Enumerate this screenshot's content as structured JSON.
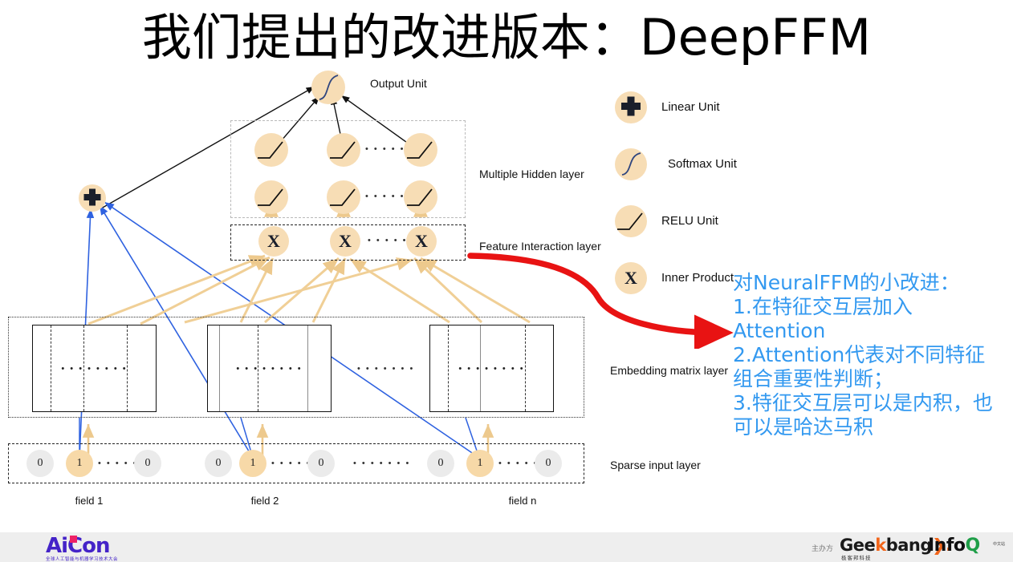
{
  "slide": {
    "title": "我们提出的改进版本：DeepFFM"
  },
  "diagram": {
    "output_unit_label": "Output Unit",
    "hidden_layer_label": "Multiple Hidden layer",
    "interaction_layer_label": "Feature Interaction layer",
    "embedding_layer_label": "Embedding matrix layer",
    "sparse_layer_label": "Sparse input layer",
    "ellipsis": "• • • • • • • •",
    "ellipsis_short": "• • • • • •",
    "linear_unit_symbol": "+",
    "inner_product_symbol": "X",
    "hidden_rows": [
      {
        "cells": [
          "relu",
          "relu",
          "ellipsis",
          "relu"
        ]
      },
      {
        "cells": [
          "relu",
          "relu",
          "ellipsis",
          "relu"
        ]
      }
    ],
    "interaction_cells": [
      "X",
      "X",
      "ellipsis",
      "X"
    ],
    "embedding_blocks": [
      {
        "dots": "• • • • • • • •"
      },
      {
        "dots": "• • • • • • • •"
      },
      {
        "dots": "• • • • • • • •"
      }
    ],
    "embedding_gap_dots": "• • • • • • •",
    "sparse_fields": [
      {
        "name": "field 1",
        "values": [
          "0",
          "1",
          "0"
        ],
        "hot_index": 1,
        "dots": "• • • • • • •"
      },
      {
        "name": "field 2",
        "values": [
          "0",
          "1",
          "0"
        ],
        "hot_index": 1,
        "dots": "• • • • • • •"
      },
      {
        "name": "field n",
        "values": [
          "0",
          "1",
          "0"
        ],
        "hot_index": 1,
        "dots": "• • • • • • •"
      }
    ],
    "sparse_gap_dots": "• • • • • • •"
  },
  "legend": {
    "items": [
      {
        "icon": "plus-icon",
        "label": "Linear Unit"
      },
      {
        "icon": "softmax-curve-icon",
        "label": "Softmax Unit"
      },
      {
        "icon": "relu-curve-icon",
        "label": "RELU Unit"
      },
      {
        "icon": "x-icon",
        "label": "Inner Product"
      }
    ]
  },
  "annotation": {
    "color": "#3399f0",
    "lines": [
      "对NeuralFFM的小改进：",
      "1.在特征交互层加入",
      "Attention",
      "2.Attention代表对不同特征",
      "组合重要性判断；",
      "3.特征交互层可以是内积，也",
      "可以是哈达马积"
    ]
  },
  "footer": {
    "aicon_word": "AiCon",
    "aicon_sub": "全球人工智能与机器学习技术大会",
    "sponsor_label": "主办方",
    "geekbang_pre": "Gee",
    "geekbang_k": "k",
    "geekbang_mid": "bang",
    "geekbang_post": "❯.",
    "geekbang_sub": "极客邦科技",
    "infoq_info": "Info",
    "infoq_q": "Q",
    "infoq_sub": "中文站"
  },
  "colors": {
    "unit_fill": "#f7ddb5",
    "sparse_zero": "#ebebeb",
    "sparse_one": "#f7d9a8",
    "blue_line": "#2f62e0",
    "tan_line": "#f0cf96",
    "red_arrow": "#e81313",
    "annotation_blue": "#3399f0"
  }
}
